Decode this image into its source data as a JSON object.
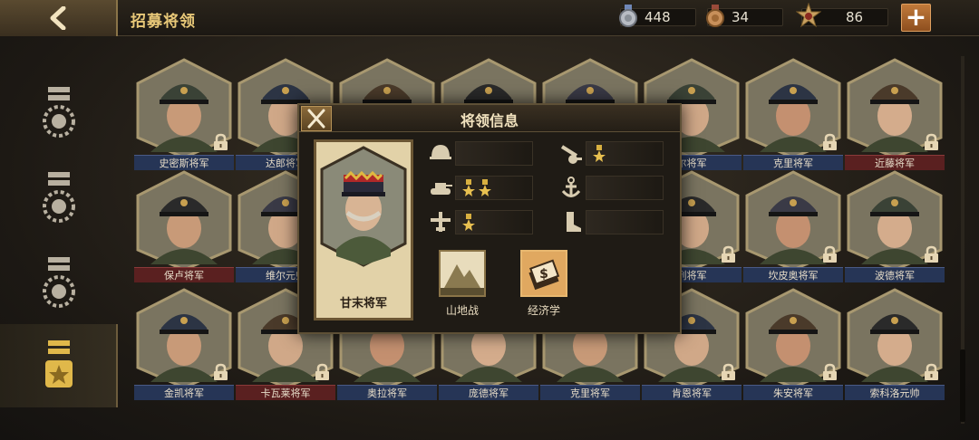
{
  "header": {
    "title": "招募将领",
    "resources": [
      {
        "name": "silver-medal",
        "value": "448"
      },
      {
        "name": "bronze-medal",
        "value": "34"
      },
      {
        "name": "star-badge",
        "value": "86"
      }
    ],
    "plus_label": "+"
  },
  "generals": [
    {
      "name": "史密斯将军",
      "plate": "blue",
      "locked": true
    },
    {
      "name": "达郎将军",
      "plate": "blue",
      "locked": false
    },
    {
      "name": "",
      "plate": "none",
      "locked": false
    },
    {
      "name": "",
      "plate": "none",
      "locked": false
    },
    {
      "name": "",
      "plate": "none",
      "locked": false
    },
    {
      "name": "尔将军",
      "plate": "blue",
      "locked": false
    },
    {
      "name": "克里将军",
      "plate": "blue",
      "locked": true
    },
    {
      "name": "近藤将军",
      "plate": "red",
      "locked": true
    },
    {
      "name": "保卢将军",
      "plate": "red",
      "locked": false
    },
    {
      "name": "维尔元帅",
      "plate": "blue",
      "locked": false
    },
    {
      "name": "",
      "plate": "none",
      "locked": false
    },
    {
      "name": "",
      "plate": "none",
      "locked": false
    },
    {
      "name": "",
      "plate": "none",
      "locked": false
    },
    {
      "name": "列将军",
      "plate": "blue",
      "locked": true
    },
    {
      "name": "坎皮奥将军",
      "plate": "blue",
      "locked": true
    },
    {
      "name": "波德将军",
      "plate": "blue",
      "locked": true
    },
    {
      "name": "金凯将军",
      "plate": "blue",
      "locked": true
    },
    {
      "name": "卡瓦莱将军",
      "plate": "red",
      "locked": true
    },
    {
      "name": "奥拉将军",
      "plate": "blue",
      "locked": false
    },
    {
      "name": "庞德将军",
      "plate": "blue",
      "locked": false
    },
    {
      "name": "克里将军",
      "plate": "blue",
      "locked": false
    },
    {
      "name": "肯恩将军",
      "plate": "blue",
      "locked": true
    },
    {
      "name": "朱安将军",
      "plate": "blue",
      "locked": true
    },
    {
      "name": "索科洛元帅",
      "plate": "blue",
      "locked": true
    }
  ],
  "modal": {
    "title": "将领信息",
    "general_name": "甘末将军",
    "stats": [
      {
        "icon": "infantry-helmet-icon",
        "stars": 0
      },
      {
        "icon": "artillery-icon",
        "stars": 1
      },
      {
        "icon": "tank-icon",
        "stars": 2
      },
      {
        "icon": "anchor-icon",
        "stars": 0
      },
      {
        "icon": "aircraft-icon",
        "stars": 1
      },
      {
        "icon": "boot-icon",
        "stars": 0
      }
    ],
    "skills": [
      {
        "icon": "mountain-icon",
        "label": "山地战"
      },
      {
        "icon": "money-icon",
        "label": "经济学"
      }
    ]
  },
  "colors": {
    "accent_gold": "#e8c878",
    "plate_blue": "#263556",
    "plate_red": "#5a2020"
  }
}
